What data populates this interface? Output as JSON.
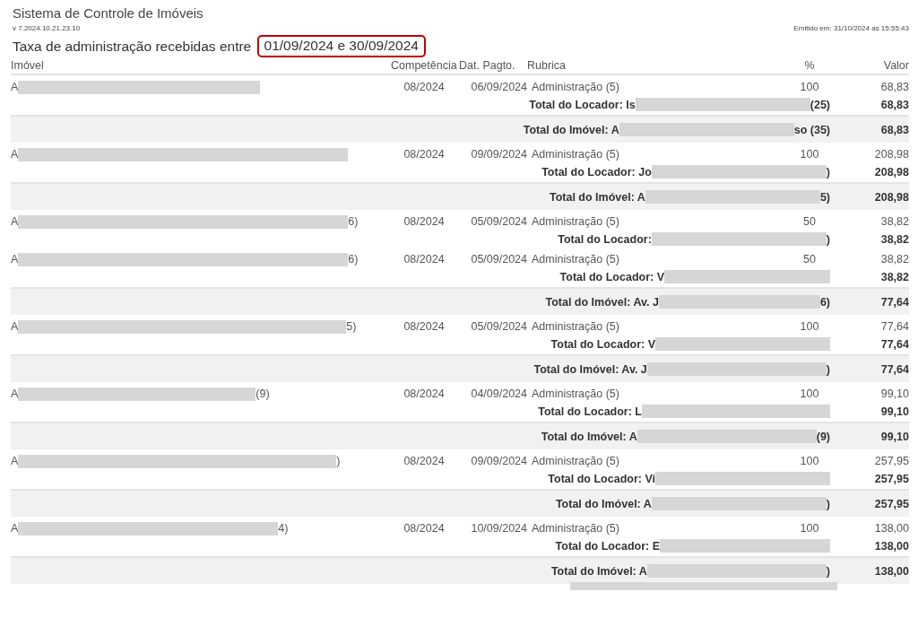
{
  "header": {
    "title": "Sistema de Controle de Imóveis",
    "version": "v 7.2024.10.21.23.10",
    "issued": "Emitido em: 31/10/2024 as 15:55:43",
    "subtitle": "Taxa de administração recebidas entre",
    "period": "01/09/2024 e 30/09/2024"
  },
  "columns": [
    "Imóvel",
    "Competência",
    "Dat. Pagto.",
    "Rubrica",
    "%",
    "Valor"
  ],
  "rows": [
    {
      "kind": "item",
      "imovel": {
        "before": "A"
      },
      "competencia": "08/2024",
      "data": "06/09/2024",
      "rubrica": "Administração (5)",
      "pct": "100",
      "valor": "68,83"
    },
    {
      "kind": "locador",
      "name": {
        "before": "Total do Locador: Is",
        "after": "(25)"
      },
      "valor": "68,83"
    },
    {
      "kind": "imovel",
      "name": {
        "before": "Total do Imóvel: A",
        "after": "so (35)"
      },
      "valor": "68,83"
    },
    {
      "kind": "item",
      "imovel": {
        "before": "A"
      },
      "competencia": "08/2024",
      "data": "09/09/2024",
      "rubrica": "Administração (5)",
      "pct": "100",
      "valor": "208,98"
    },
    {
      "kind": "locador",
      "name": {
        "before": "Total do Locador: Jo",
        "after": ")"
      },
      "valor": "208,98"
    },
    {
      "kind": "imovel",
      "name": {
        "before": "Total do Imóvel: A",
        "after": "5)"
      },
      "valor": "208,98"
    },
    {
      "kind": "item",
      "imovel": {
        "before": "A",
        "after": "6)"
      },
      "competencia": "08/2024",
      "data": "05/09/2024",
      "rubrica": "Administração (5)",
      "pct": "50",
      "valor": "38,82"
    },
    {
      "kind": "locador",
      "name": {
        "before": "Total do Locador:",
        "after": ")"
      },
      "valor": "38,82"
    },
    {
      "kind": "item",
      "imovel": {
        "before": "A",
        "after": "6)"
      },
      "competencia": "08/2024",
      "data": "05/09/2024",
      "rubrica": "Administração (5)",
      "pct": "50",
      "valor": "38,82"
    },
    {
      "kind": "locador",
      "name": {
        "before": "Total do Locador: V"
      },
      "valor": "38,82"
    },
    {
      "kind": "imovel",
      "name": {
        "before": "Total do Imóvel: Av. J",
        "after": "6)"
      },
      "valor": "77,64"
    },
    {
      "kind": "item",
      "imovel": {
        "before": "A",
        "after": "5)"
      },
      "competencia": "08/2024",
      "data": "05/09/2024",
      "rubrica": "Administração (5)",
      "pct": "100",
      "valor": "77,64"
    },
    {
      "kind": "locador",
      "name": {
        "before": "Total do Locador: V"
      },
      "valor": "77,64"
    },
    {
      "kind": "imovel",
      "name": {
        "before": "Total do Imóvel: Av. J",
        "after": ")"
      },
      "valor": "77,64"
    },
    {
      "kind": "item",
      "imovel": {
        "before": "A",
        "after": "(9)"
      },
      "competencia": "08/2024",
      "data": "04/09/2024",
      "rubrica": "Administração (5)",
      "pct": "100",
      "valor": "99,10"
    },
    {
      "kind": "locador",
      "name": {
        "before": "Total do Locador: L"
      },
      "valor": "99,10"
    },
    {
      "kind": "imovel",
      "name": {
        "before": "Total do Imóvel: A",
        "after": "(9)"
      },
      "valor": "99,10"
    },
    {
      "kind": "item",
      "imovel": {
        "before": "A",
        "after": ")"
      },
      "competencia": "08/2024",
      "data": "09/09/2024",
      "rubrica": "Administração (5)",
      "pct": "100",
      "valor": "257,95"
    },
    {
      "kind": "locador",
      "name": {
        "before": "Total do Locador: Vi"
      },
      "valor": "257,95"
    },
    {
      "kind": "imovel",
      "name": {
        "before": "Total do Imóvel: A",
        "after": ")"
      },
      "valor": "257,95"
    },
    {
      "kind": "item",
      "imovel": {
        "before": "A",
        "after": "4)"
      },
      "competencia": "08/2024",
      "data": "10/09/2024",
      "rubrica": "Administração (5)",
      "pct": "100",
      "valor": "138,00"
    },
    {
      "kind": "locador",
      "name": {
        "before": "Total do Locador: E"
      },
      "valor": "138,00"
    },
    {
      "kind": "imovel",
      "name": {
        "before": "Total do Imóvel: A",
        "after": ")"
      },
      "valor": "138,00",
      "second_line_redacted": true
    }
  ]
}
